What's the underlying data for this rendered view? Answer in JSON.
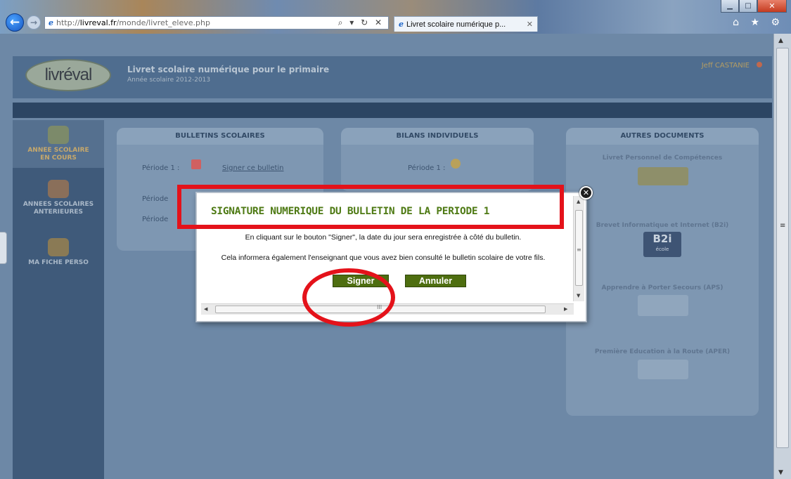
{
  "browser": {
    "url_prefix": "http://",
    "url_domain": "livreval.fr",
    "url_path": "/monde/livret_eleve.php",
    "address_tools": "⌕ ▾ ↻ ✕",
    "tab_title": "Livret scolaire numérique p...",
    "tab_close": "✕",
    "ie_glyph": "e",
    "toolbar_icons": "⌂ ★ ⚙",
    "win_min": "▁",
    "win_max": "□",
    "win_close": "✕"
  },
  "site": {
    "logo_text": "livréval",
    "title": "Livret scolaire numérique pour le primaire",
    "school_year": "Année scolaire 2012-2013",
    "user": "Jeff CASTANIE"
  },
  "side_menu": {
    "items": [
      {
        "label_1": "ANNEE SCOLAIRE",
        "label_2": "EN COURS"
      },
      {
        "label_1": "ANNEES SCOLAIRES",
        "label_2": "ANTERIEURES"
      },
      {
        "label_1": "MA FICHE PERSO",
        "label_2": ""
      }
    ]
  },
  "panels": {
    "bulletins": {
      "heading": "BULLETINS SCOLAIRES",
      "period1_label": "Période 1 :",
      "sign_link": "Signer ce bulletin",
      "period2_label": "Période",
      "period3_label": "Période"
    },
    "bilans": {
      "heading": "BILANS INDIVIDUELS",
      "period1_label": "Période 1 :"
    },
    "autres": {
      "heading": "AUTRES DOCUMENTS",
      "doc1": "Livret Personnel de Compétences",
      "doc2": "Brevet Informatique et Internet (B2i)",
      "doc2_badge": "B2i",
      "doc2_badge_sub": "école",
      "doc3": "Apprendre à Porter Secours (APS)",
      "doc4": "Première Education à la Route (APER)"
    }
  },
  "modal": {
    "title": "SIGNATURE NUMERIQUE DU BULLETIN DE LA PERIODE 1",
    "line1": "En cliquant sur le bouton \"Signer\", la date du jour sera enregistrée à côté du bulletin.",
    "line2": "Cela informera également l'enseignant que vous avez bien consulté le bulletin scolaire de votre fils.",
    "btn_sign": "Signer",
    "btn_cancel": "Annuler",
    "close_glyph": "✕",
    "scroll_grip_v": "≡",
    "scroll_grip_h": "III"
  },
  "colors": {
    "modal_title": "#4e7a14",
    "button_bg": "#4e6e10",
    "annotation": "#e4121a"
  }
}
